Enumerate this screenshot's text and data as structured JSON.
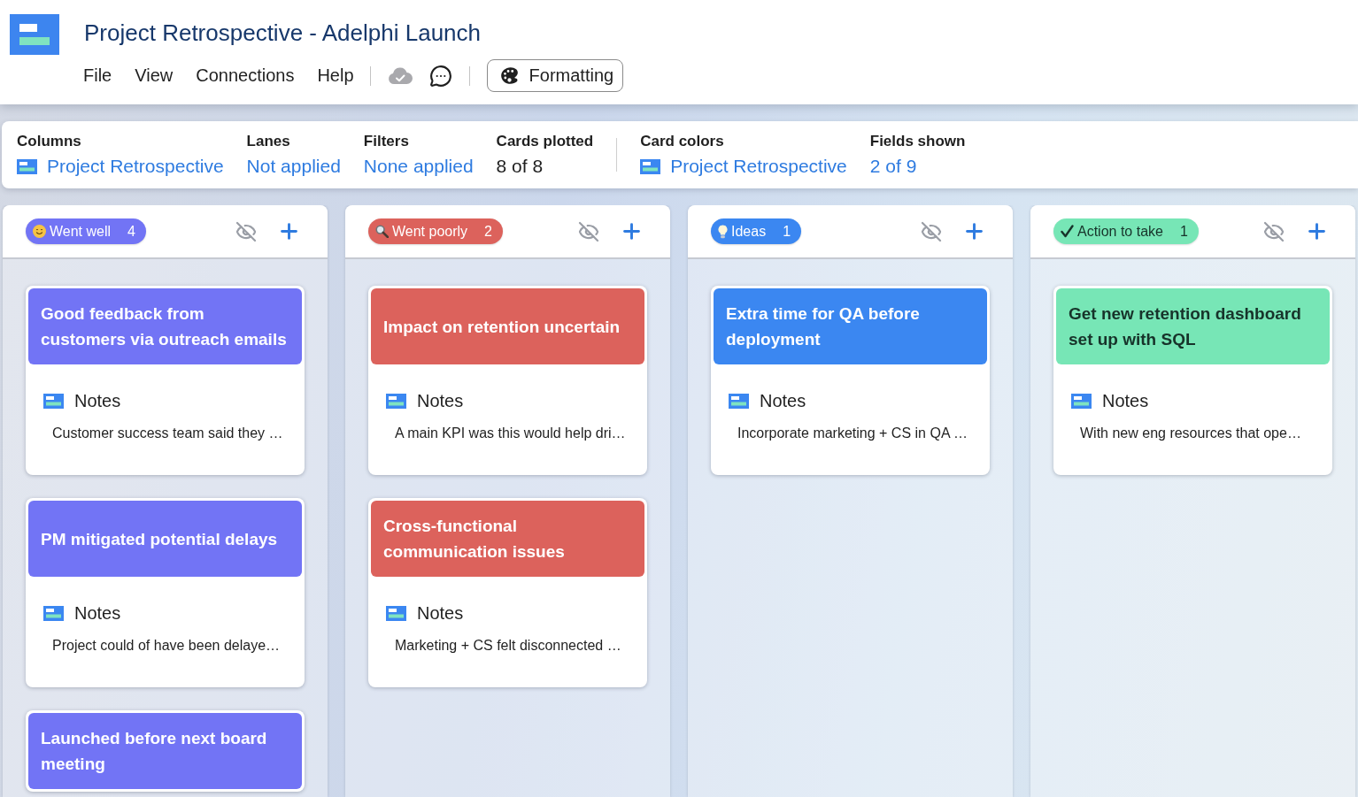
{
  "app": {
    "title": "Project Retrospective - Adelphi Launch",
    "menu": [
      "File",
      "View",
      "Connections",
      "Help"
    ],
    "formatting_button": "Formatting"
  },
  "summary": [
    {
      "items": [
        {
          "label": "Columns",
          "value": "Project Retrospective",
          "kind": "source"
        },
        {
          "label": "Lanes",
          "value": "Not applied",
          "kind": "link"
        },
        {
          "label": "Filters",
          "value": "None applied",
          "kind": "link"
        },
        {
          "label": "Cards plotted",
          "value": "8 of 8",
          "kind": "count"
        }
      ]
    },
    {
      "items": [
        {
          "label": "Card colors",
          "value": "Project Retrospective",
          "kind": "source"
        },
        {
          "label": "Fields shown",
          "value": "2 of 9",
          "kind": "link"
        }
      ]
    }
  ],
  "columns": [
    {
      "label": "Went well",
      "count": "4",
      "kind": "smile",
      "color": "#7274f5",
      "cards": [
        {
          "title": "Good feedback from customers via outreach emails",
          "fields": [
            {
              "label": "Notes",
              "value": "Customer success team said they …"
            }
          ]
        },
        {
          "title": "PM mitigated potential delays",
          "fields": [
            {
              "label": "Notes",
              "value": "Project could of have been delaye…"
            }
          ]
        },
        {
          "title": "Launched before next board meeting"
        }
      ]
    },
    {
      "label": "Went poorly",
      "count": "2",
      "kind": "magnifier",
      "color": "#dc625c",
      "cards": [
        {
          "title": "Impact on retention uncertain",
          "fields": [
            {
              "label": "Notes",
              "value": "A main KPI was this would help dri…"
            }
          ]
        },
        {
          "title": "Cross-functional communication issues",
          "fields": [
            {
              "label": "Notes",
              "value": "Marketing + CS felt disconnected …"
            }
          ]
        }
      ]
    },
    {
      "label": "Ideas",
      "count": "1",
      "kind": "bulb",
      "color": "#3b87f1",
      "cards": [
        {
          "title": "Extra time for QA before deployment",
          "fields": [
            {
              "label": "Notes",
              "value": "Incorporate marketing + CS in QA …"
            }
          ]
        }
      ]
    },
    {
      "label": "Action to take",
      "count": "1",
      "kind": "check",
      "color": "#77e6b6",
      "cards": [
        {
          "title": "Get new retention dashboard set up with SQL",
          "fields": [
            {
              "label": "Notes",
              "value": "With new eng resources that ope…"
            }
          ]
        }
      ]
    }
  ]
}
